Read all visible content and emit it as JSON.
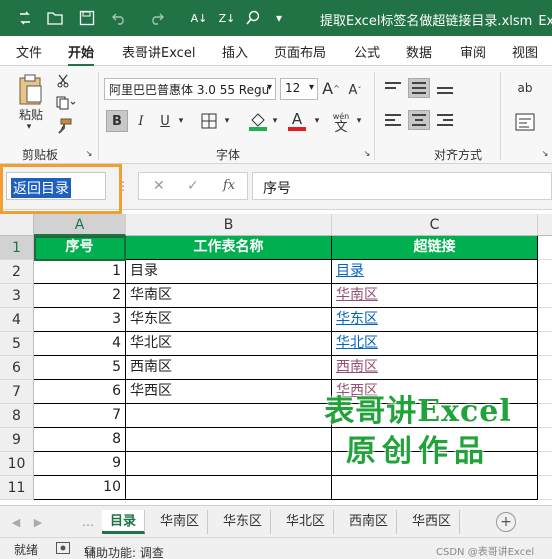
{
  "titlebar": {
    "document_title": "提取Excel标签名做超链接目录.xlsm",
    "truncated_suffix": "Exc",
    "icons": [
      "autosave-icon",
      "folder-icon",
      "save-icon",
      "undo-icon",
      "redo-icon",
      "sort-icon",
      "filter-icon",
      "search-icon",
      "more-icon"
    ]
  },
  "ribbon_tabs": [
    "文件",
    "开始",
    "表哥讲Excel",
    "插入",
    "页面布局",
    "公式",
    "数据",
    "审阅",
    "视图"
  ],
  "active_tab": "开始",
  "ribbon": {
    "clipboard": {
      "paste_label": "粘贴",
      "group_label": "剪贴板"
    },
    "font": {
      "font_name": "阿里巴巴普惠体 3.0 55 Regu",
      "font_size": "12",
      "grow_font": "A",
      "shrink_font": "A",
      "bold": "B",
      "italic": "I",
      "underline": "U",
      "font_color_letter": "A",
      "phonetic_top": "wén",
      "phonetic_bottom": "文",
      "group_label": "字体"
    },
    "alignment": {
      "group_label": "对齐方式",
      "orientation_icon_text": "ab"
    }
  },
  "formula_bar": {
    "name_box": "返回目录",
    "cancel_icon": "✕",
    "enter_icon": "✓",
    "fx_label": "fx",
    "formula": "序号"
  },
  "grid": {
    "columns": [
      "A",
      "B",
      "C"
    ],
    "rows": [
      "1",
      "2",
      "3",
      "4",
      "5",
      "6",
      "7",
      "8",
      "9",
      "10",
      "11"
    ],
    "header_row": [
      "序号",
      "工作表名称",
      "超链接"
    ],
    "data": [
      {
        "no": "1",
        "name": "目录",
        "link": "目录",
        "visited": false
      },
      {
        "no": "2",
        "name": "华南区",
        "link": "华南区",
        "visited": true
      },
      {
        "no": "3",
        "name": "华东区",
        "link": "华东区",
        "visited": false
      },
      {
        "no": "4",
        "name": "华北区",
        "link": "华北区",
        "visited": false
      },
      {
        "no": "5",
        "name": "西南区",
        "link": "西南区",
        "visited": true
      },
      {
        "no": "6",
        "name": "华西区",
        "link": "华西区",
        "visited": true
      },
      {
        "no": "7",
        "name": "",
        "link": "",
        "visited": false
      },
      {
        "no": "8",
        "name": "",
        "link": "",
        "visited": false
      },
      {
        "no": "9",
        "name": "",
        "link": "",
        "visited": false
      },
      {
        "no": "10",
        "name": "",
        "link": "",
        "visited": false
      }
    ],
    "watermark_line1": "表哥讲Excel",
    "watermark_line2": "原创作品"
  },
  "sheet_tabs": [
    "目录",
    "华南区",
    "华东区",
    "华北区",
    "西南区",
    "华西区"
  ],
  "active_sheet": "目录",
  "statusbar": {
    "ready": "就绪",
    "accessibility": "辅助功能: 调查",
    "credit": "CSDN @表哥讲Excel"
  },
  "colors": {
    "excel_green": "#217346",
    "header_fill": "#00b050",
    "watermark": "#22a33a",
    "highlight": "#f0a030"
  }
}
